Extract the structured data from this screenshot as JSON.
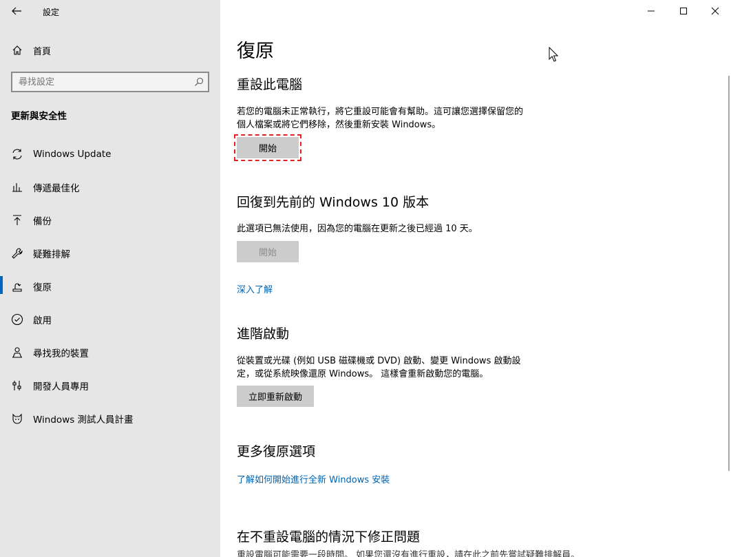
{
  "window": {
    "title": "設定",
    "controls": {
      "minimize": "minimize-icon",
      "maximize": "maximize-icon",
      "close": "close-icon"
    }
  },
  "sidebar": {
    "home": {
      "label": "首頁",
      "icon": "home-icon"
    },
    "search": {
      "placeholder": "尋找設定",
      "value": ""
    },
    "section": "更新與安全性",
    "items": [
      {
        "label": "Windows Update",
        "icon": "refresh-icon",
        "active": false
      },
      {
        "label": "傳遞最佳化",
        "icon": "delivery-optimization-icon",
        "active": false
      },
      {
        "label": "備份",
        "icon": "backup-upload-icon",
        "active": false
      },
      {
        "label": "疑難排解",
        "icon": "wrench-icon",
        "active": false
      },
      {
        "label": "復原",
        "icon": "recovery-icon",
        "active": true
      },
      {
        "label": "啟用",
        "icon": "check-circle-icon",
        "active": false
      },
      {
        "label": "尋找我的裝置",
        "icon": "person-locate-icon",
        "active": false
      },
      {
        "label": "開發人員專用",
        "icon": "developer-sliders-icon",
        "active": false
      },
      {
        "label": "Windows 測試人員計畫",
        "icon": "insider-cat-icon",
        "active": false
      }
    ]
  },
  "main": {
    "title": "復原",
    "reset": {
      "heading": "重設此電腦",
      "description_line1": "若您的電腦未正常執行，將它重設可能會有幫助。這可讓您選擇保留您的",
      "description_line2": "個人檔案或將它們移除，然後重新安裝 Windows。",
      "button": "開始"
    },
    "rollback": {
      "heading": "回復到先前的 Windows 10 版本",
      "description": "此選項已無法使用，因為您的電腦在更新之後已經過 10 天。",
      "button": "開始",
      "link": "深入了解"
    },
    "advanced": {
      "heading": "進階啟動",
      "description_line1": "從裝置或光碟 (例如 USB 磁碟機或 DVD) 啟動、變更 Windows 啟動設",
      "description_line2": "定，或從系統映像還原 Windows。 這樣會重新啟動您的電腦。",
      "button": "立即重新啟動"
    },
    "more": {
      "heading": "更多復原選項",
      "link": "了解如何開始進行全新 Windows 安裝"
    },
    "fix": {
      "heading": "在不重設電腦的情況下修正問題",
      "description": "重設電腦可能需要一段時間。 如果您還沒有進行重設，請在此之前先嘗試疑難排解員。"
    }
  },
  "colors": {
    "accent": "#0067c0",
    "link": "#0063b1",
    "sidebar_bg": "#e6e6e6",
    "button_bg": "#cccccc",
    "highlight": "#e02020"
  }
}
